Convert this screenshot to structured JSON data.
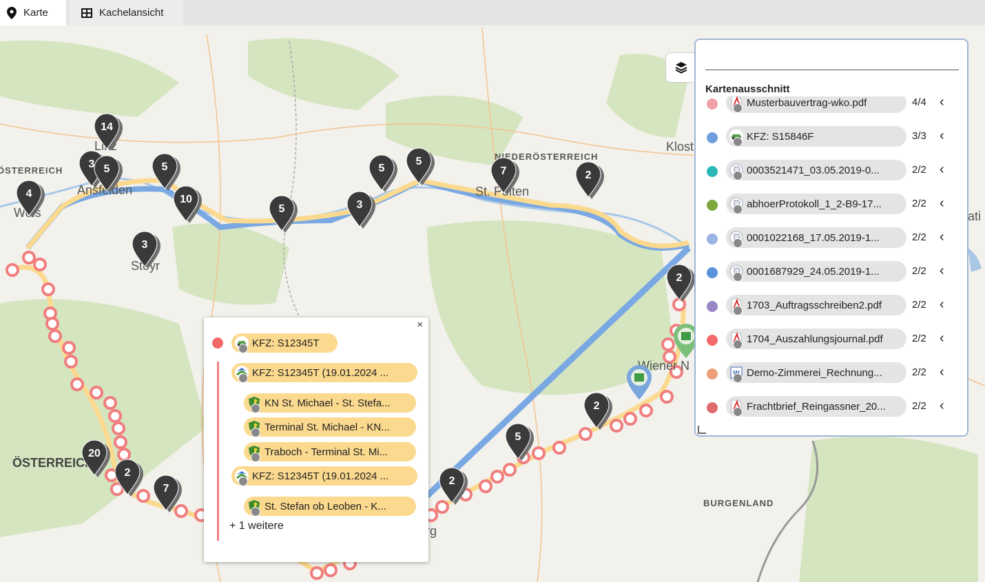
{
  "tabs": [
    {
      "label": "Karte",
      "icon": "map-marker-icon"
    },
    {
      "label": "Kachelansicht",
      "icon": "grid-icon"
    }
  ],
  "map": {
    "places": [
      "Linz",
      "Ansfelden",
      "Wels",
      "Steyr",
      "St. Pölten",
      "Klost",
      "Wiener N",
      "ÖSTERREICH",
      "rg",
      "ati"
    ],
    "regions": [
      "ÖSTERREICH",
      "NIEDERÖSTERREICH",
      "BURGENLAND"
    ],
    "cluster_markers": [
      "14",
      "3",
      "5",
      "5",
      "10",
      "4",
      "3",
      "5",
      "3",
      "5",
      "5",
      "7",
      "2",
      "2",
      "2",
      "5",
      "2",
      "20",
      "2",
      "7"
    ]
  },
  "popup": {
    "close": "×",
    "header": "KFZ: S12345T",
    "items": [
      {
        "label": "KFZ: S12345T (19.01.2024 ...",
        "type": "route"
      },
      {
        "label": "KN St. Michael - St. Stefa...",
        "type": "shield"
      },
      {
        "label": "Terminal St. Michael - KN...",
        "type": "shield"
      },
      {
        "label": "Traboch - Terminal St. Mi...",
        "type": "shield"
      },
      {
        "label": "KFZ: S12345T (19.01.2024 ...",
        "type": "route"
      },
      {
        "label": "St. Stefan ob Leoben - K...",
        "type": "shield"
      }
    ],
    "more": "+ 1 weitere"
  },
  "panel": {
    "title": "Kartenausschnitt",
    "rows": [
      {
        "label": "Musterbauvertrag-wko.pdf",
        "count": "4/4",
        "color": "#f0a0a8",
        "icon": "pdf-icon"
      },
      {
        "label": "KFZ: S15846F",
        "count": "3/3",
        "color": "#6f9fe0",
        "icon": "car-icon"
      },
      {
        "label": "0003521471_03.05.2019-0...",
        "count": "2/2",
        "color": "#2bb8b8",
        "icon": "file-icon"
      },
      {
        "label": "abhoerProtokoll_1_2-B9-17...",
        "count": "2/2",
        "color": "#7ea83c",
        "icon": "file-icon"
      },
      {
        "label": "0001022168_17.05.2019-1...",
        "count": "2/2",
        "color": "#9bb3e2",
        "icon": "file-icon"
      },
      {
        "label": "0001687929_24.05.2019-1...",
        "count": "2/2",
        "color": "#5a92dc",
        "icon": "file-icon"
      },
      {
        "label": "1703_Auftragsschreiben2.pdf",
        "count": "2/2",
        "color": "#9a86c6",
        "icon": "pdf-icon"
      },
      {
        "label": "1704_Auszahlungsjournal.pdf",
        "count": "2/2",
        "color": "#f26a6a",
        "icon": "pdf-icon"
      },
      {
        "label": "Demo-Zimmerei_Rechnung...",
        "count": "2/2",
        "color": "#ee9f7a",
        "icon": "word-icon"
      },
      {
        "label": "Frachtbrief_Reingassner_20...",
        "count": "2/2",
        "color": "#e06a6a",
        "icon": "pdf-icon"
      }
    ]
  }
}
